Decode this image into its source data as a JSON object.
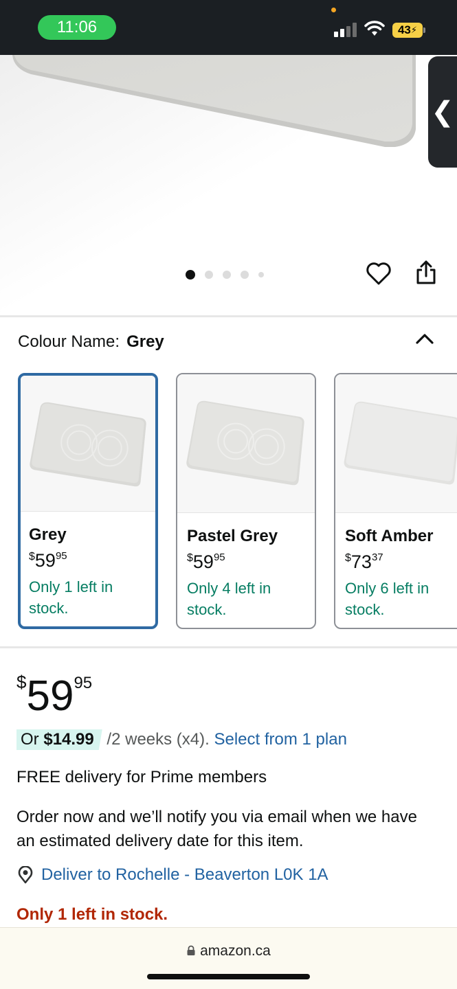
{
  "status_bar": {
    "time": "11:06",
    "battery": "43"
  },
  "carousel": {
    "total_images": 5,
    "active_index": 0
  },
  "colour": {
    "label": "Colour Name:",
    "selected": "Grey"
  },
  "swatches": [
    {
      "name": "Grey",
      "price_symbol": "$",
      "price_whole": "59",
      "price_fraction": "95",
      "stock": "Only 1 left in stock.",
      "selected": true
    },
    {
      "name": "Pastel Grey",
      "price_symbol": "$",
      "price_whole": "59",
      "price_fraction": "95",
      "stock": "Only 4 left in stock.",
      "selected": false
    },
    {
      "name": "Soft Amber",
      "price_symbol": "$",
      "price_whole": "73",
      "price_fraction": "37",
      "stock": "Only 6 left in stock.",
      "selected": false
    }
  ],
  "price": {
    "symbol": "$",
    "whole": "59",
    "fraction": "95"
  },
  "installment": {
    "prefix": "Or",
    "amount": "$14.99",
    "terms": "/2 weeks (x4).",
    "link": "Select from 1 plan"
  },
  "delivery": {
    "prime": "FREE delivery for Prime members",
    "note": "Order now and we’ll notify you via email when we have an estimated delivery date for this item.",
    "deliver_to": "Deliver to Rochelle - Beaverton L0K 1A"
  },
  "stock_warning": "Only 1 left in stock.",
  "browser": {
    "url": "amazon.ca"
  },
  "colors": {
    "accent_link": "#2162a1",
    "stock_green": "#067d62",
    "warning_red": "#b12704",
    "selected_border": "#2f6aa3",
    "installment_badge": "#d7f5ef"
  },
  "icons": [
    "heart-icon",
    "share-icon",
    "chevron-up-icon",
    "location-pin-icon",
    "lock-icon",
    "chevron-left-icon",
    "wifi-icon",
    "signal-icon",
    "battery-icon"
  ]
}
